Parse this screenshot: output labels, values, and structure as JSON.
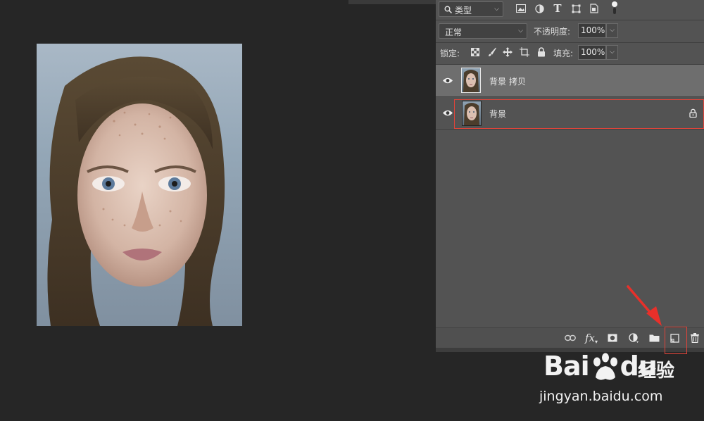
{
  "filter": {
    "kind_label": "类型"
  },
  "blend": {
    "mode": "正常",
    "opacity_label": "不透明度:",
    "opacity_value": "100%"
  },
  "lock": {
    "label": "锁定:",
    "fill_label": "填充:",
    "fill_value": "100%"
  },
  "layers": [
    {
      "name": "背景 拷贝",
      "selected": true,
      "locked": false
    },
    {
      "name": "背景",
      "selected": false,
      "locked": true
    }
  ],
  "watermark": {
    "brand_left": "Bai",
    "brand_right": "du",
    "product": "经验",
    "url": "jingyan.baidu.com"
  },
  "colors": {
    "panel": "#535353",
    "canvas_bg": "#262626",
    "highlight": "#e0443a",
    "selected_layer": "#6e6e6e"
  }
}
